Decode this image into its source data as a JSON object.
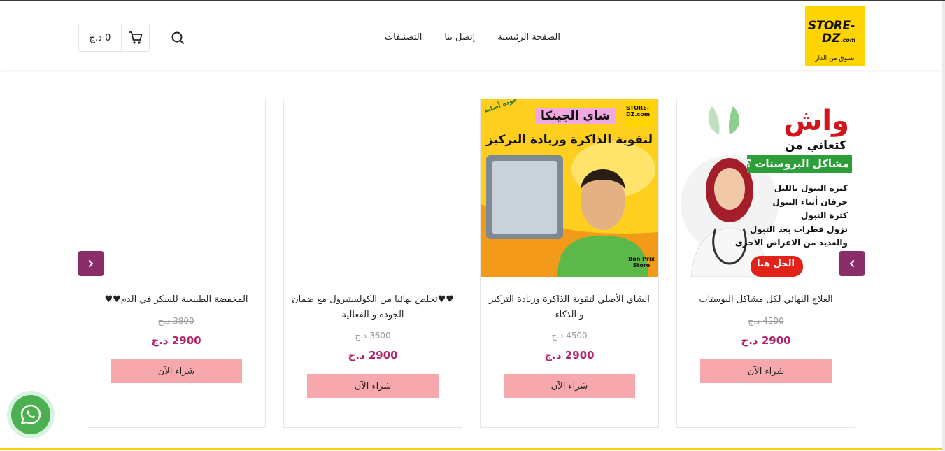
{
  "header": {
    "logo": {
      "line1": "STORE-",
      "line2": "DZ",
      "line2_small": ".com",
      "tagline": "تسوق من الدار"
    },
    "nav": [
      {
        "label": "الصفحة الرئيسية"
      },
      {
        "label": "إتصل بنا"
      },
      {
        "label": "التصنيفات"
      }
    ],
    "cart_total": "0 د.ج",
    "icons": {
      "search": "search-icon",
      "cart": "cart-icon"
    }
  },
  "products": [
    {
      "title": "العلاج النهائي لكل مشاكل البوستات",
      "old_price": "4500 د.ج",
      "price": "2900 د.ج",
      "button": "شراء الآن",
      "image": {
        "headline": "واش",
        "sub": "كتعاني من",
        "banner": "مشاكل البروستات ؟",
        "bullets": [
          "كثرة التبول بالليل",
          "حرقان أثناء التبول",
          "كثرة التبول",
          "نزول قطرات بعد التبول",
          "والعديد من الاعراض الاخرى"
        ],
        "cta": "الحل هنا"
      }
    },
    {
      "title": "الشاي الأصلي لتقوية الذاكرة وزيادة التركيز و الذكاء",
      "old_price": "4500 د.ج",
      "price": "2900 د.ج",
      "button": "شراء الآن",
      "image": {
        "label": "شاي الجينكا",
        "headline": "لتقوية الذاكرة وزيادة التركيز",
        "badge": "جودة أصلية",
        "corner": "Bon Prix Store",
        "logo": "STORE-DZ.com"
      }
    },
    {
      "title": "♥♥تخلص نهائيا من الكولستيرول مع ضمان الجودة و الفعالية",
      "old_price": "3600 د.ج",
      "price": "2900 د.ج",
      "button": "شراء الآن"
    },
    {
      "title": "المخفضة الطبيعية للسكر في الدم♥♥",
      "old_price": "3800 د.ج",
      "price": "2900 د.ج",
      "button": "شراء الآن"
    }
  ],
  "carousel": {
    "prev_icon": "chevron-left-icon",
    "next_icon": "chevron-right-icon"
  },
  "colors": {
    "accent": "#b0246e",
    "button": "#f6a8ad",
    "arrow": "#8a2d68",
    "logo_bg": "#ffd400",
    "whatsapp": "#4caf50"
  },
  "whatsapp": {
    "icon": "whatsapp-icon"
  }
}
